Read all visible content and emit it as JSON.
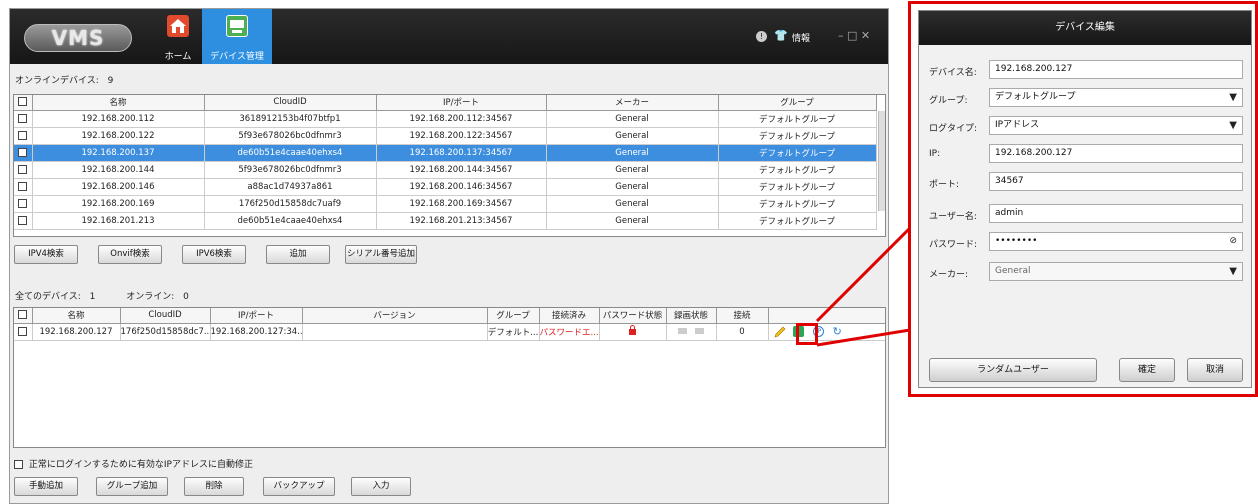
{
  "header": {
    "logo": "VMS",
    "tabs": [
      {
        "label": "ホーム",
        "icon": "home-icon"
      },
      {
        "label": "デバイス管理",
        "icon": "device-manage-icon"
      }
    ],
    "info_label": "情報",
    "window_controls": "– □ ✕"
  },
  "online": {
    "title": "オンラインデバイス:",
    "count": "9",
    "columns": [
      "名称",
      "CloudID",
      "IP/ポート",
      "メーカー",
      "グループ"
    ],
    "rows": [
      [
        "192.168.200.112",
        "3618912153b4f07btfp1",
        "192.168.200.112:34567",
        "General",
        "デフォルトグループ"
      ],
      [
        "192.168.200.122",
        "5f93e678026bc0dfnmr3",
        "192.168.200.122:34567",
        "General",
        "デフォルトグループ"
      ],
      [
        "192.168.200.137",
        "de60b51e4caae40ehxs4",
        "192.168.200.137:34567",
        "General",
        "デフォルトグループ"
      ],
      [
        "192.168.200.144",
        "5f93e678026bc0dfnmr3",
        "192.168.200.144:34567",
        "General",
        "デフォルトグループ"
      ],
      [
        "192.168.200.146",
        "a88ac1d74937a861",
        "192.168.200.146:34567",
        "General",
        "デフォルトグループ"
      ],
      [
        "192.168.200.169",
        "176f250d15858dc7uaf9",
        "192.168.200.169:34567",
        "General",
        "デフォルトグループ"
      ],
      [
        "192.168.201.213",
        "de60b51e4caae40ehxs4",
        "192.168.201.213:34567",
        "General",
        "デフォルトグループ"
      ]
    ],
    "selected_row": 2
  },
  "search_buttons": [
    "IPV4検索",
    "Onvif検索",
    "IPV6検索",
    "追加",
    "シリアル番号追加"
  ],
  "added": {
    "all_label": "全てのデバイス:",
    "all_count": "1",
    "online_label": "オンライン:",
    "online_count": "0",
    "columns": [
      "名称",
      "CloudID",
      "IP/ポート",
      "バージョン",
      "グループ",
      "接続済み",
      "パスワード状態",
      "録画状態",
      "接続"
    ],
    "row": [
      "192.168.200.127",
      "176f250d15858dc7...",
      "192.168.200.127:34...",
      "",
      "デフォルト...",
      "パスワードエ...",
      "",
      "",
      "0"
    ]
  },
  "auto_fix_label": "正常にログインするために有効なIPアドレスに自動修正",
  "bottom_buttons": [
    "手動追加",
    "グループ追加",
    "削除",
    "バックアップ",
    "入力"
  ],
  "dialog": {
    "title": "デバイス編集",
    "fields": [
      {
        "label": "デバイス名:",
        "value": "192.168.200.127"
      },
      {
        "label": "グループ:",
        "value": "デフォルトグループ"
      },
      {
        "label": "ログタイプ:",
        "value": "IPアドレス"
      },
      {
        "label": "IP:",
        "value": "192.168.200.127"
      },
      {
        "label": "ポート:",
        "value": "34567"
      },
      {
        "label": "ユーザー名:",
        "value": "admin"
      },
      {
        "label": "パスワード:",
        "value": "••••••••"
      },
      {
        "label": "メーカー:",
        "value": "General"
      }
    ],
    "buttons": [
      "ランダムユーザー",
      "確定",
      "取消"
    ]
  },
  "colors": {
    "header": "#1c1c1c",
    "selection": "#3d8ede",
    "highlight": "#e00000",
    "error_text": "#e02020"
  }
}
